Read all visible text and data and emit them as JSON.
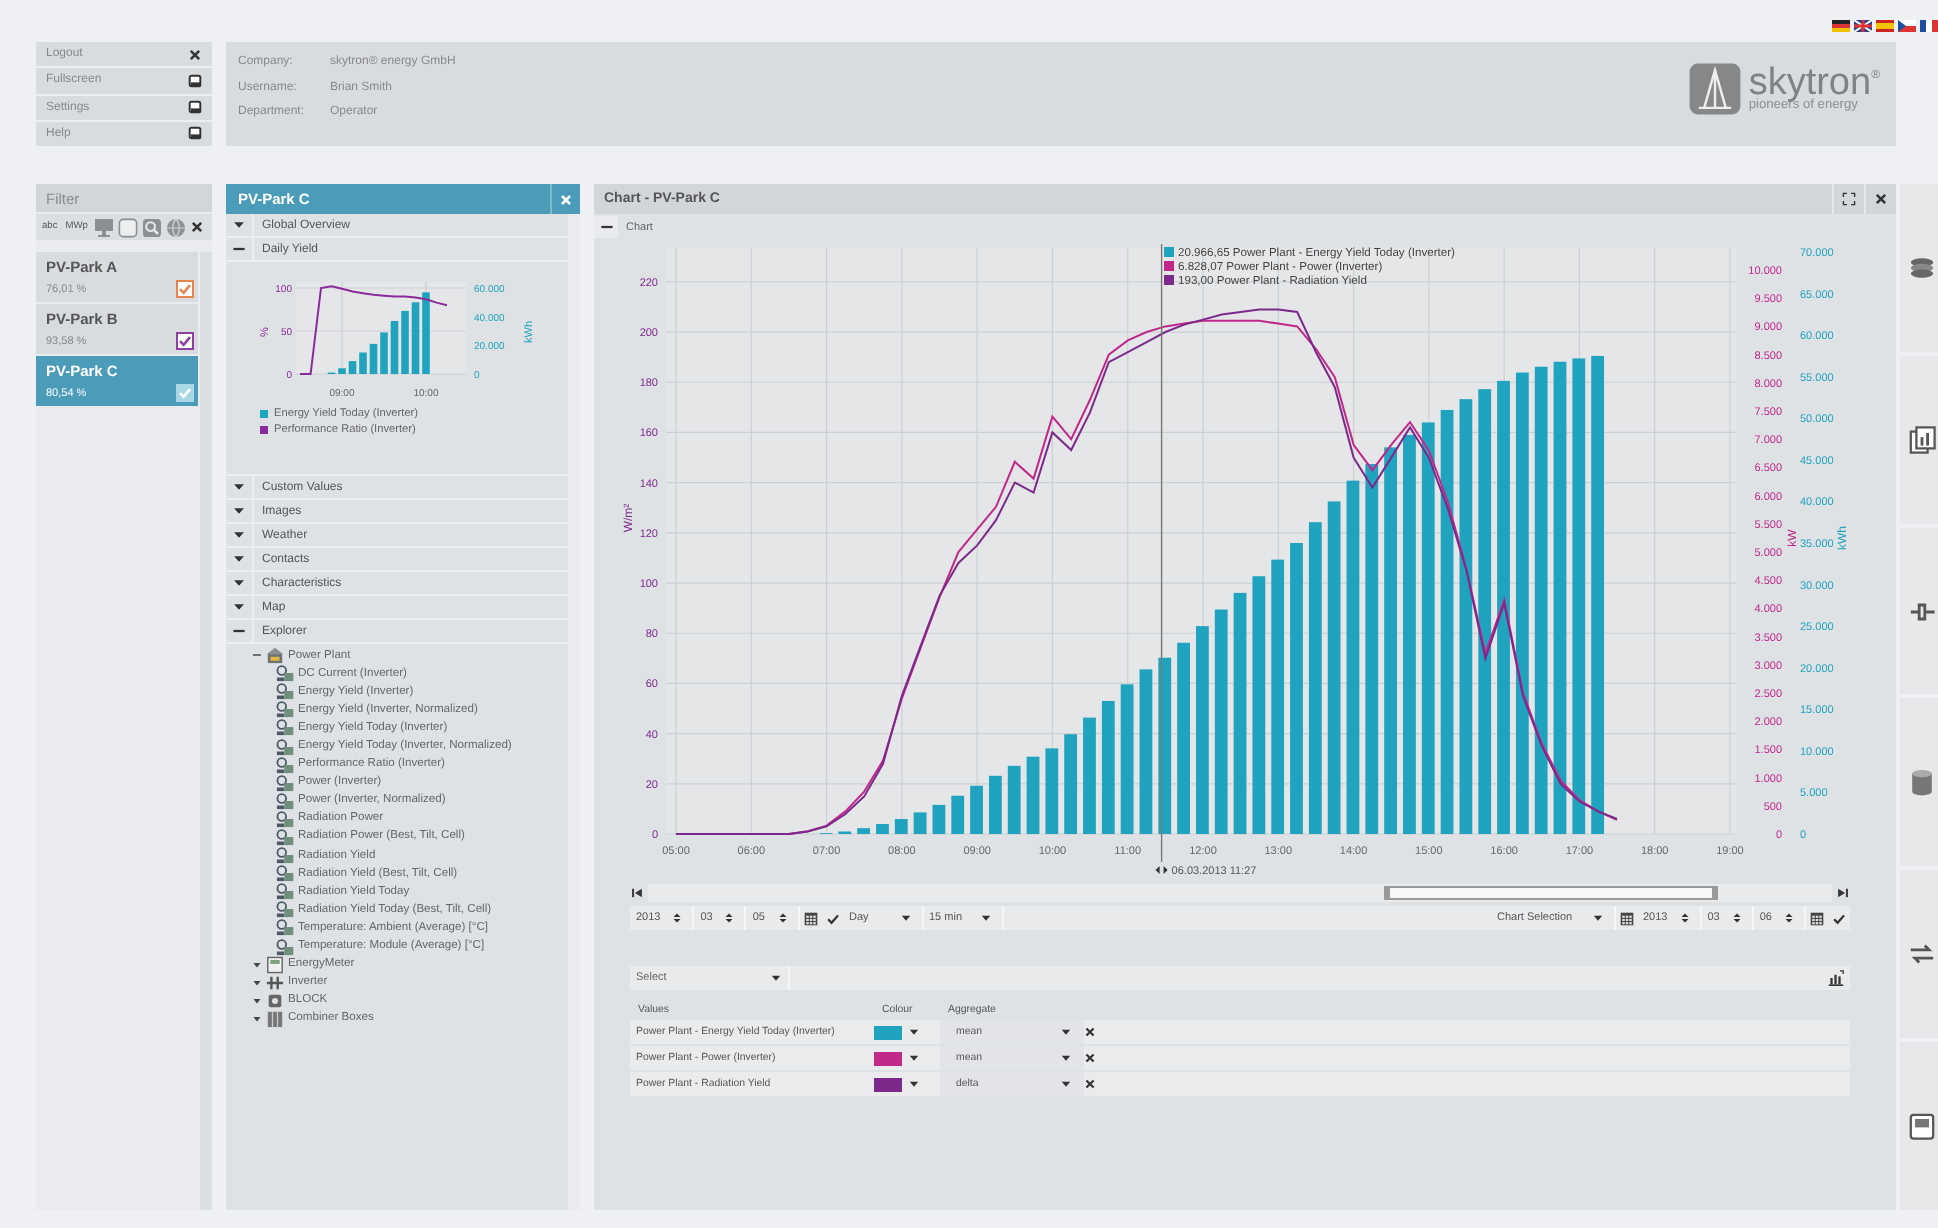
{
  "header": {
    "menu": [
      {
        "label": "Logout"
      },
      {
        "label": "Fullscreen"
      },
      {
        "label": "Settings"
      },
      {
        "label": "Help"
      }
    ],
    "account": [
      {
        "label": "Company:",
        "value": "skytron® energy GmbH"
      },
      {
        "label": "Username:",
        "value": "Brian Smith"
      },
      {
        "label": "Department:",
        "value": "Operator"
      }
    ],
    "logo": {
      "name": "skytron",
      "mark": "®",
      "tagline": "pioneers of energy"
    }
  },
  "filter": {
    "title": "Filter",
    "tools": [
      {
        "kind": "text",
        "label": "abc"
      },
      {
        "kind": "text",
        "label": "MWp"
      },
      {
        "kind": "monitor"
      },
      {
        "kind": "square"
      },
      {
        "kind": "search"
      },
      {
        "kind": "globe"
      },
      {
        "kind": "close"
      }
    ],
    "parks": [
      {
        "name": "PV-Park A",
        "value": "76,01 %",
        "checked": true,
        "color": "#e8834e",
        "selected": false
      },
      {
        "name": "PV-Park B",
        "value": "93,58 %",
        "checked": true,
        "color": "#8e3fa0",
        "selected": false
      },
      {
        "name": "PV-Park C",
        "value": "80,54 %",
        "checked": true,
        "color": "#a8d8e6",
        "selected": true
      }
    ]
  },
  "park_panel": {
    "title": "PV-Park C",
    "sections": [
      {
        "label": "Global Overview",
        "expanded": false
      },
      {
        "label": "Daily Yield",
        "expanded": true,
        "chart": {
          "chart_data": {
            "type": "bar",
            "x": [
              8.5,
              8.625,
              8.75,
              8.875,
              9,
              9.125,
              9.25,
              9.375,
              9.5,
              9.625,
              9.75,
              9.875,
              10,
              10.125,
              10.25
            ],
            "xlim": [
              8.5,
              10.476
            ],
            "grid": true,
            "legend": "bottom",
            "ylim": [
              0,
              107
            ],
            "ylabel": "%",
            "yticks": [
              0,
              50,
              100
            ],
            "y2lim": [
              0,
              64186
            ],
            "y2label": "kWh",
            "y2ticks": [
              {
                "value": 0,
                "label": "0"
              },
              {
                "value": 20000,
                "label": "20.000"
              },
              {
                "value": 40000,
                "label": "40.000"
              },
              {
                "value": 60000,
                "label": "60.000"
              }
            ],
            "xticks": [
              {
                "value": 9,
                "label": "09:00"
              },
              {
                "value": 10,
                "label": "10:00"
              }
            ],
            "series": [
              {
                "name": "Energy Yield Today (Inverter)",
                "color": "#1fa3bf",
                "type": "bar",
                "axis": "y2",
                "values": [
                  null,
                  null,
                  null,
                  1000,
                  4000,
                  9000,
                  15000,
                  21000,
                  29000,
                  37000,
                  44000,
                  50000,
                  57000,
                  null,
                  null
                ]
              },
              {
                "name": "Performance Ratio (Inverter)",
                "color": "#8b2a9a",
                "type": "line",
                "values": [
                  0,
                  0,
                  100,
                  102,
                  99,
                  96,
                  94,
                  92,
                  91,
                  90,
                  90,
                  89,
                  87,
                  83,
                  80
                ]
              }
            ]
          }
        }
      },
      {
        "label": "Custom Values",
        "expanded": false
      },
      {
        "label": "Images",
        "expanded": false
      },
      {
        "label": "Weather",
        "expanded": false
      },
      {
        "label": "Contacts",
        "expanded": false
      },
      {
        "label": "Characteristics",
        "expanded": false
      },
      {
        "label": "Map",
        "expanded": false
      },
      {
        "label": "Explorer",
        "expanded": true,
        "tree": [
          {
            "label": "Power Plant",
            "kind": "plant",
            "expanded": true,
            "children": [
              {
                "label": "DC Current (Inverter)",
                "kind": "sensor"
              },
              {
                "label": "Energy Yield (Inverter)",
                "kind": "sensor"
              },
              {
                "label": "Energy Yield (Inverter, Normalized)",
                "kind": "sensor"
              },
              {
                "label": "Energy Yield Today (Inverter)",
                "kind": "sensor"
              },
              {
                "label": "Energy Yield Today (Inverter, Normalized)",
                "kind": "sensor"
              },
              {
                "label": "Performance Ratio (Inverter)",
                "kind": "sensor"
              },
              {
                "label": "Power (Inverter)",
                "kind": "sensor"
              },
              {
                "label": "Power (Inverter, Normalized)",
                "kind": "sensor"
              },
              {
                "label": "Radiation Power",
                "kind": "sensor"
              },
              {
                "label": "Radiation Power (Best, Tilt, Cell)",
                "kind": "sensor"
              },
              {
                "label": "Radiation Yield",
                "kind": "sensor"
              },
              {
                "label": "Radiation Yield (Best, Tilt, Cell)",
                "kind": "sensor"
              },
              {
                "label": "Radiation Yield Today",
                "kind": "sensor"
              },
              {
                "label": "Radiation Yield Today (Best, Tilt, Cell)",
                "kind": "sensor"
              },
              {
                "label": "Temperature: Ambient (Average) [°C]",
                "kind": "sensor"
              },
              {
                "label": "Temperature: Module (Average) [°C]",
                "kind": "sensor"
              }
            ]
          },
          {
            "label": "EnergyMeter",
            "kind": "meter",
            "expanded": false
          },
          {
            "label": "Inverter",
            "kind": "inverter",
            "expanded": false
          },
          {
            "label": "BLOCK",
            "kind": "block",
            "expanded": false
          },
          {
            "label": "Combiner Boxes",
            "kind": "combiner",
            "expanded": false
          }
        ]
      }
    ]
  },
  "chart_panel": {
    "title": "Chart - PV-Park C",
    "section": {
      "label": "Chart",
      "expanded": true
    },
    "chart": {
      "chart_data": {
        "type": "bar",
        "x": [
          5,
          5.25,
          5.5,
          5.75,
          6,
          6.25,
          6.5,
          6.75,
          7,
          7.25,
          7.5,
          7.75,
          8,
          8.25,
          8.5,
          8.75,
          9,
          9.25,
          9.5,
          9.75,
          10,
          10.25,
          10.5,
          10.75,
          11,
          11.25,
          11.5,
          11.75,
          12,
          12.25,
          12.5,
          12.75,
          13,
          13.25,
          13.5,
          13.75,
          14,
          14.25,
          14.5,
          14.75,
          15,
          15.25,
          15.5,
          15.75,
          16,
          16.25,
          16.5,
          16.75,
          17,
          17.25,
          17.5
        ],
        "xlim": [
          4.92,
          19.08
        ],
        "grid": true,
        "legend": "top",
        "ref_lines": [
          {
            "axis": "x",
            "value": 11.45,
            "label": "06.03.2013 11:27"
          }
        ],
        "ylim": [
          0,
          233.5
        ],
        "ylabel": "W/m²",
        "yticks": [
          0,
          20,
          40,
          60,
          80,
          100,
          120,
          140,
          160,
          180,
          200,
          220
        ],
        "y2lim": [
          0,
          10390
        ],
        "y2label": "kW",
        "y2ticks": [
          {
            "value": 0,
            "label": "0"
          },
          {
            "value": 500,
            "label": "500"
          },
          {
            "value": 1000,
            "label": "1.000"
          },
          {
            "value": 1500,
            "label": "1.500"
          },
          {
            "value": 2000,
            "label": "2.000"
          },
          {
            "value": 2500,
            "label": "2.500"
          },
          {
            "value": 3000,
            "label": "3.000"
          },
          {
            "value": 3500,
            "label": "3.500"
          },
          {
            "value": 4000,
            "label": "4.000"
          },
          {
            "value": 4500,
            "label": "4.500"
          },
          {
            "value": 5000,
            "label": "5.000"
          },
          {
            "value": 5500,
            "label": "5.500"
          },
          {
            "value": 6000,
            "label": "6.000"
          },
          {
            "value": 6500,
            "label": "6.500"
          },
          {
            "value": 7000,
            "label": "7.000"
          },
          {
            "value": 7500,
            "label": "7.500"
          },
          {
            "value": 8000,
            "label": "8.000"
          },
          {
            "value": 8500,
            "label": "8.500"
          },
          {
            "value": 9000,
            "label": "9.000"
          },
          {
            "value": 9500,
            "label": "9.500"
          },
          {
            "value": 10000,
            "label": "10.000"
          }
        ],
        "y3lim": [
          0,
          70480
        ],
        "y3label": "kWh",
        "y3ticks": [
          {
            "value": 0,
            "label": "0"
          },
          {
            "value": 5000,
            "label": "5.000"
          },
          {
            "value": 10000,
            "label": "10.000"
          },
          {
            "value": 15000,
            "label": "15.000"
          },
          {
            "value": 20000,
            "label": "20.000"
          },
          {
            "value": 25000,
            "label": "25.000"
          },
          {
            "value": 30000,
            "label": "30.000"
          },
          {
            "value": 35000,
            "label": "35.000"
          },
          {
            "value": 40000,
            "label": "40.000"
          },
          {
            "value": 45000,
            "label": "45.000"
          },
          {
            "value": 50000,
            "label": "50.000"
          },
          {
            "value": 55000,
            "label": "55.000"
          },
          {
            "value": 60000,
            "label": "60.000"
          },
          {
            "value": 65000,
            "label": "65.000"
          },
          {
            "value": 70000,
            "label": "70.000"
          }
        ],
        "xticks": [
          {
            "value": 5,
            "label": "05:00"
          },
          {
            "value": 6,
            "label": "06:00"
          },
          {
            "value": 7,
            "label": "07:00"
          },
          {
            "value": 8,
            "label": "08:00"
          },
          {
            "value": 9,
            "label": "09:00"
          },
          {
            "value": 10,
            "label": "10:00"
          },
          {
            "value": 11,
            "label": "11:00"
          },
          {
            "value": 12,
            "label": "12:00"
          },
          {
            "value": 13,
            "label": "13:00"
          },
          {
            "value": 14,
            "label": "14:00"
          },
          {
            "value": 15,
            "label": "15:00"
          },
          {
            "value": 16,
            "label": "16:00"
          },
          {
            "value": 17,
            "label": "17:00"
          },
          {
            "value": 18,
            "label": "18:00"
          },
          {
            "value": 19,
            "label": "19:00"
          }
        ],
        "series": [
          {
            "name": "20.966,65 Power Plant - Energy Yield Today (Inverter)",
            "color": "#1fa3bf",
            "type": "bar",
            "axis": "y3",
            "values": [
              null,
              null,
              null,
              null,
              null,
              null,
              null,
              null,
              100,
              300,
              700,
              1200,
              1800,
              2600,
              3500,
              4600,
              5800,
              7000,
              8200,
              9300,
              10300,
              12000,
              14000,
              16000,
              18000,
              19800,
              21200,
              23000,
              25000,
              27000,
              29000,
              31000,
              33000,
              35000,
              37500,
              40000,
              42500,
              44500,
              46500,
              48000,
              49500,
              51000,
              52300,
              53500,
              54500,
              55500,
              56200,
              56800,
              57200,
              57500,
              null
            ]
          },
          {
            "name": "6.828,07 Power Plant - Power (Inverter)",
            "color": "#c0288a",
            "type": "line",
            "axis": "y2",
            "values": [
              null,
              null,
              null,
              null,
              null,
              0,
              0,
              50,
              150,
              400,
              750,
              1300,
              2400,
              3300,
              4200,
              5000,
              5400,
              5800,
              6600,
              6300,
              7400,
              7000,
              7700,
              8500,
              8750,
              8900,
              9000,
              9050,
              9100,
              9100,
              9100,
              9100,
              9050,
              9000,
              8600,
              8100,
              6900,
              6450,
              6900,
              7300,
              6800,
              5900,
              4700,
              3200,
              4150,
              2500,
              1600,
              950,
              600,
              400,
              250
            ]
          },
          {
            "name": "193,00 Power Plant - Radiation Yield",
            "color": "#7b2a8c",
            "type": "line",
            "values": [
              0,
              0,
              0,
              0,
              0,
              0,
              0,
              1,
              3,
              8,
              15,
              28,
              55,
              75,
              95,
              108,
              115,
              125,
              140,
              136,
              160,
              153,
              168,
              188,
              192,
              196,
              200,
              203,
              205,
              207,
              208,
              209,
              209,
              208,
              192,
              178,
              150,
              138,
              150,
              162,
              150,
              130,
              105,
              70,
              92,
              55,
              35,
              20,
              13,
              9,
              6
            ]
          }
        ]
      }
    },
    "controls": {
      "from": {
        "year": "2013",
        "month": "03",
        "day": "05"
      },
      "period": "Day",
      "interval": "15 min",
      "selection": "Chart Selection",
      "to": {
        "year": "2013",
        "month": "03",
        "day": "06"
      }
    },
    "series_select": {
      "placeholder": "Select"
    },
    "table": {
      "columns": [
        "Values",
        "Colour",
        "Aggregate"
      ],
      "rows": [
        {
          "name": "Power Plant - Energy Yield Today (Inverter)",
          "color": "#1fa3bf",
          "aggregate": "mean"
        },
        {
          "name": "Power Plant - Power (Inverter)",
          "color": "#c0288a",
          "aggregate": "mean"
        },
        {
          "name": "Power Plant - Radiation Yield",
          "color": "#7b2a8c",
          "aggregate": "delta"
        }
      ]
    }
  }
}
